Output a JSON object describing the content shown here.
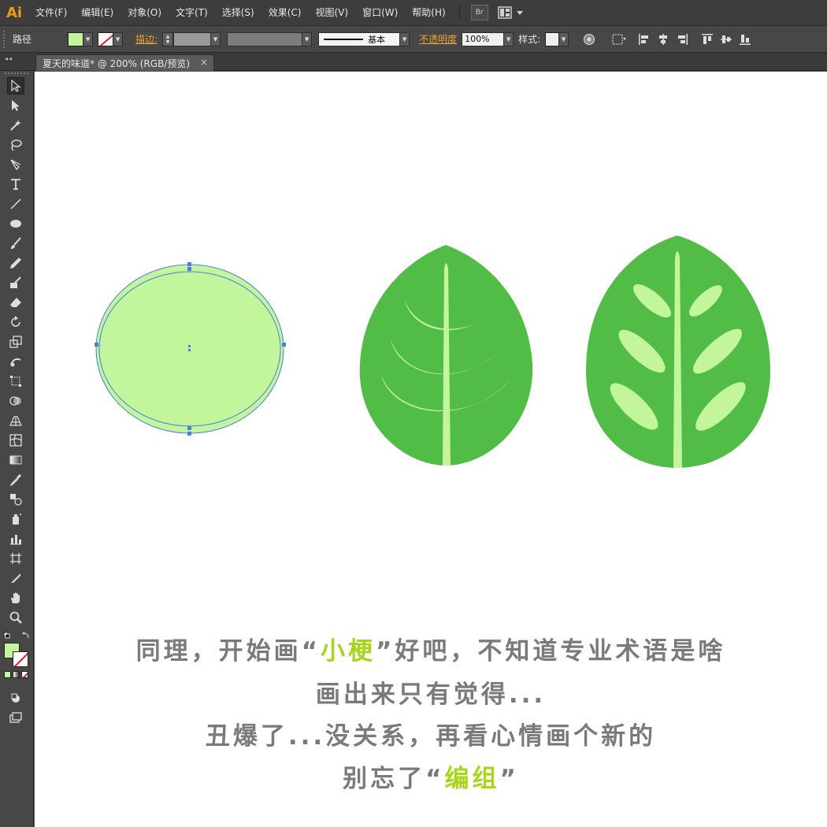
{
  "app": {
    "logo": "Ai",
    "accent_color": "#f29a1c"
  },
  "menu": {
    "items": [
      {
        "label": "文件(F)"
      },
      {
        "label": "编辑(E)"
      },
      {
        "label": "对象(O)"
      },
      {
        "label": "文字(T)"
      },
      {
        "label": "选择(S)"
      },
      {
        "label": "效果(C)"
      },
      {
        "label": "视图(V)"
      },
      {
        "label": "窗口(W)"
      },
      {
        "label": "帮助(H)"
      }
    ],
    "bridge_label": "Br",
    "workspace_icon": "arrange-documents-icon"
  },
  "control": {
    "selection_type": "路径",
    "fill_color": "#c2f59c",
    "stroke_label": "描边:",
    "stroke_style_label": "基本",
    "opacity_label": "不透明度",
    "opacity_value": "100%",
    "style_label": "样式:"
  },
  "document": {
    "tab_title": "夏天的味道* @ 200% (RGB/预览)",
    "close_symbol": "×"
  },
  "tools": {
    "fill_color": "#c2f59c",
    "items": [
      "selection-tool-icon",
      "direct-selection-tool-icon",
      "magic-wand-tool-icon",
      "lasso-tool-icon",
      "pen-tool-icon",
      "type-tool-icon",
      "line-tool-icon",
      "ellipse-tool-icon",
      "paintbrush-tool-icon",
      "pencil-tool-icon",
      "blob-brush-tool-icon",
      "eraser-tool-icon",
      "rotate-tool-icon",
      "scale-tool-icon",
      "warp-tool-icon",
      "free-transform-tool-icon",
      "shape-builder-tool-icon",
      "perspective-grid-tool-icon",
      "mesh-tool-icon",
      "gradient-tool-icon",
      "eyedropper-tool-icon",
      "blend-tool-icon",
      "symbol-sprayer-tool-icon",
      "column-graph-tool-icon",
      "artboard-tool-icon",
      "slice-tool-icon",
      "hand-tool-icon",
      "zoom-tool-icon"
    ]
  },
  "artwork": {
    "colors": {
      "leaf": "#52bd46",
      "vein": "#c2f59c",
      "ellipse_fill": "#c2f59c",
      "selection": "#4a7fe0"
    },
    "caption": {
      "line1_a": "同理，开始画“",
      "line1_hl": "小梗",
      "line1_b": "”好吧，不知道专业术语是啥",
      "line2": "画出来只有觉得...",
      "line3": "丑爆了...没关系，再看心情画个新的",
      "line4_a": "别忘了“",
      "line4_hl": "编组",
      "line4_b": "”",
      "highlight_color": "#a6d61a",
      "text_color": "#7a7a7a"
    }
  }
}
